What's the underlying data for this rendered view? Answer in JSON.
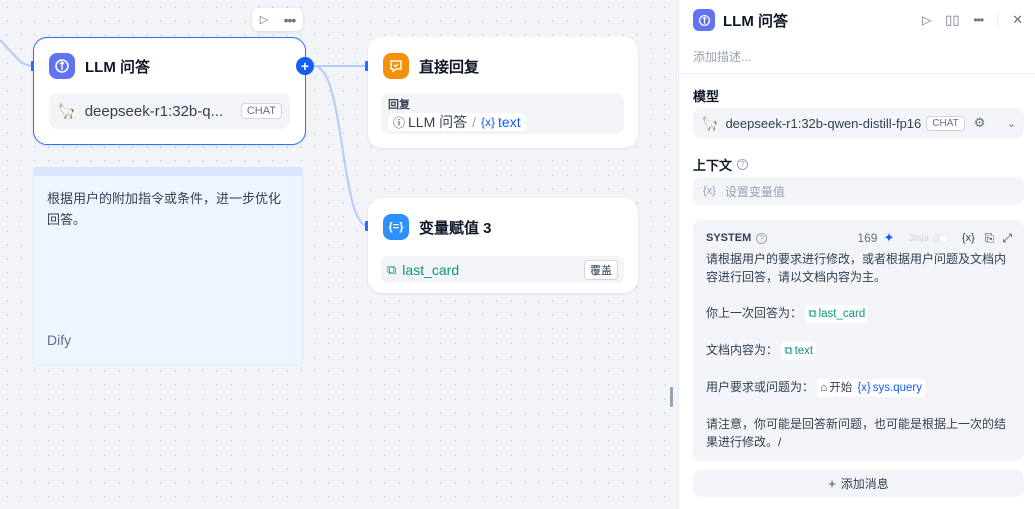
{
  "canvas": {
    "llm_node": {
      "title": "LLM 问答",
      "model": "deepseek-r1:32b-q...",
      "model_badge": "CHAT"
    },
    "reply_node": {
      "title": "直接回复",
      "field_label": "回复",
      "ref_node": "LLM 问答",
      "ref_sep": "/",
      "ref_var": "text"
    },
    "assign_node": {
      "title": "变量赋值 3",
      "var": "last_card",
      "mode": "覆盖"
    },
    "note": {
      "text": "根据用户的附加指令或条件，进一步优化回答。",
      "author": "Dify"
    }
  },
  "panel": {
    "title": "LLM 问答",
    "description_placeholder": "添加描述...",
    "model_label": "模型",
    "model_name": "deepseek-r1:32b-qwen-distill-fp16",
    "model_badge": "CHAT",
    "context_label": "上下文",
    "context_placeholder": "设置变量值",
    "system": {
      "label": "SYSTEM",
      "count": "169",
      "jinja_label": "Jinja",
      "line1": "请根据用户的要求进行修改，或者根据用户问题及文档内容进行回答，请以文档内容为主。",
      "line2_prefix": "你上一次回答为：",
      "line2_var": "last_card",
      "line3_prefix": "文档内容为：",
      "line3_var": "text",
      "line4_prefix": "用户要求或问题为：",
      "line4_node": "开始",
      "line4_var": "sys.query",
      "line5": "请注意，你可能是回答新问题，也可能是根据上一次的结果进行修改。/"
    },
    "add_message": "添加消息"
  },
  "colors": {
    "accent": "#2970ff",
    "llm_icon": "#6172f3",
    "reply_icon": "#f79009",
    "assign_icon": "#2e90fa",
    "env_var": "#0e9384"
  }
}
